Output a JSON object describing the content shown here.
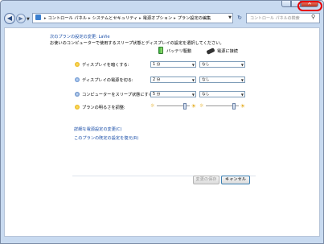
{
  "navbar": {
    "path": [
      "コントロール パネル",
      "システムとセキュリティ",
      "電源オプション",
      "プラン設定の編集"
    ],
    "search_placeholder": "コントロール パネルの検索"
  },
  "plan": {
    "title": "次のプランの設定の変更: LaVie",
    "description": "お使いのコンピューターで使用するスリープ状態とディスプレイの設定を選択してください。"
  },
  "columns": {
    "battery": "バッテリ駆動",
    "plugged_in": "電源に接続"
  },
  "rows": [
    {
      "label": "ディスプレイを暗くする:",
      "battery": "1 分",
      "plugged": "なし"
    },
    {
      "label": "ディスプレイの電源を切る:",
      "battery": "2 分",
      "plugged": "なし"
    },
    {
      "label": "コンピューターをスリープ状態にする:",
      "battery": "5 分",
      "plugged": "なし"
    }
  ],
  "brightness": {
    "label": "プランの明るさを調整:",
    "battery_level": 0.9,
    "plugged_level": 0.9
  },
  "links": {
    "advanced": "詳細な電源設定の変更(C)",
    "restore": "このプランの既定の設定を復元(R)"
  },
  "buttons": {
    "save": "変更の保存",
    "cancel": "キャンセル"
  },
  "colors": {
    "link": "#1a4ea8",
    "close": "#c6331c",
    "highlight": "#e60000"
  }
}
